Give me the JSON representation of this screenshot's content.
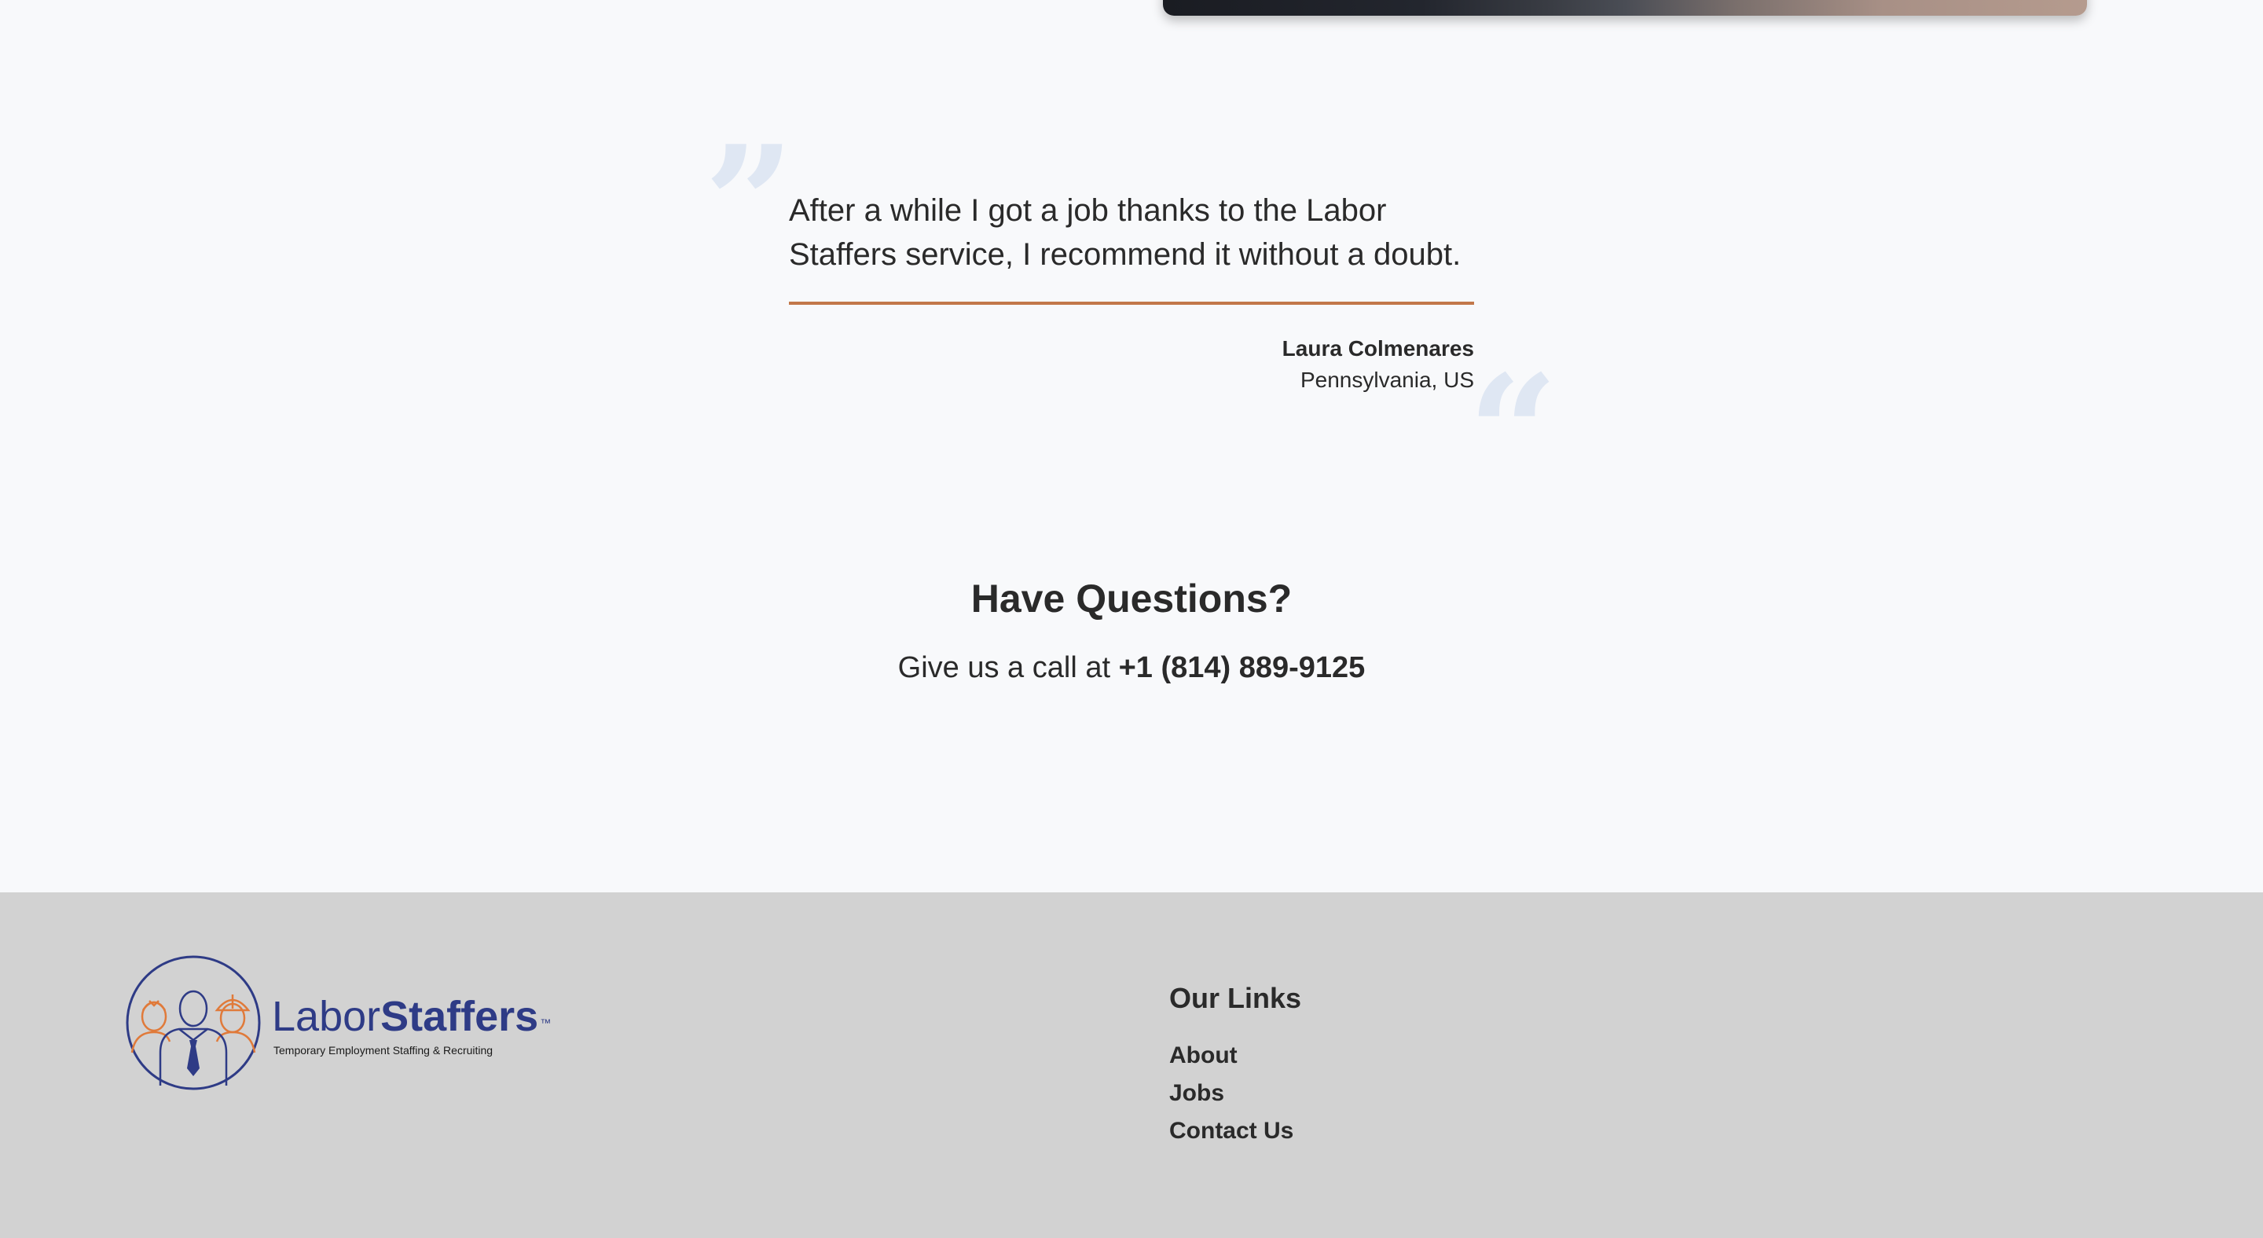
{
  "testimonial": {
    "quote": "After a while I got a job thanks to the Labor Staffers service, I recommend it without a doubt.",
    "author_name": "Laura Colmenares",
    "author_location": "Pennsylvania, US"
  },
  "questions": {
    "heading": "Have Questions?",
    "call_prefix": "Give us a call at ",
    "phone": "+1 (814) 889-9125"
  },
  "footer": {
    "logo": {
      "word_light": "Labor",
      "word_bold": "Staffers",
      "trademark": "™",
      "tagline": "Temporary Employment Staffing & Recruiting"
    },
    "links_heading": "Our Links",
    "links": [
      "About",
      "Jobs",
      "Contact Us"
    ]
  },
  "colors": {
    "page_bg": "#f8f9fb",
    "footer_bg": "#d2d2d2",
    "accent_orange": "#c2784a",
    "brand_blue": "#2e3b86",
    "quote_mark": "#dfe7f3"
  }
}
